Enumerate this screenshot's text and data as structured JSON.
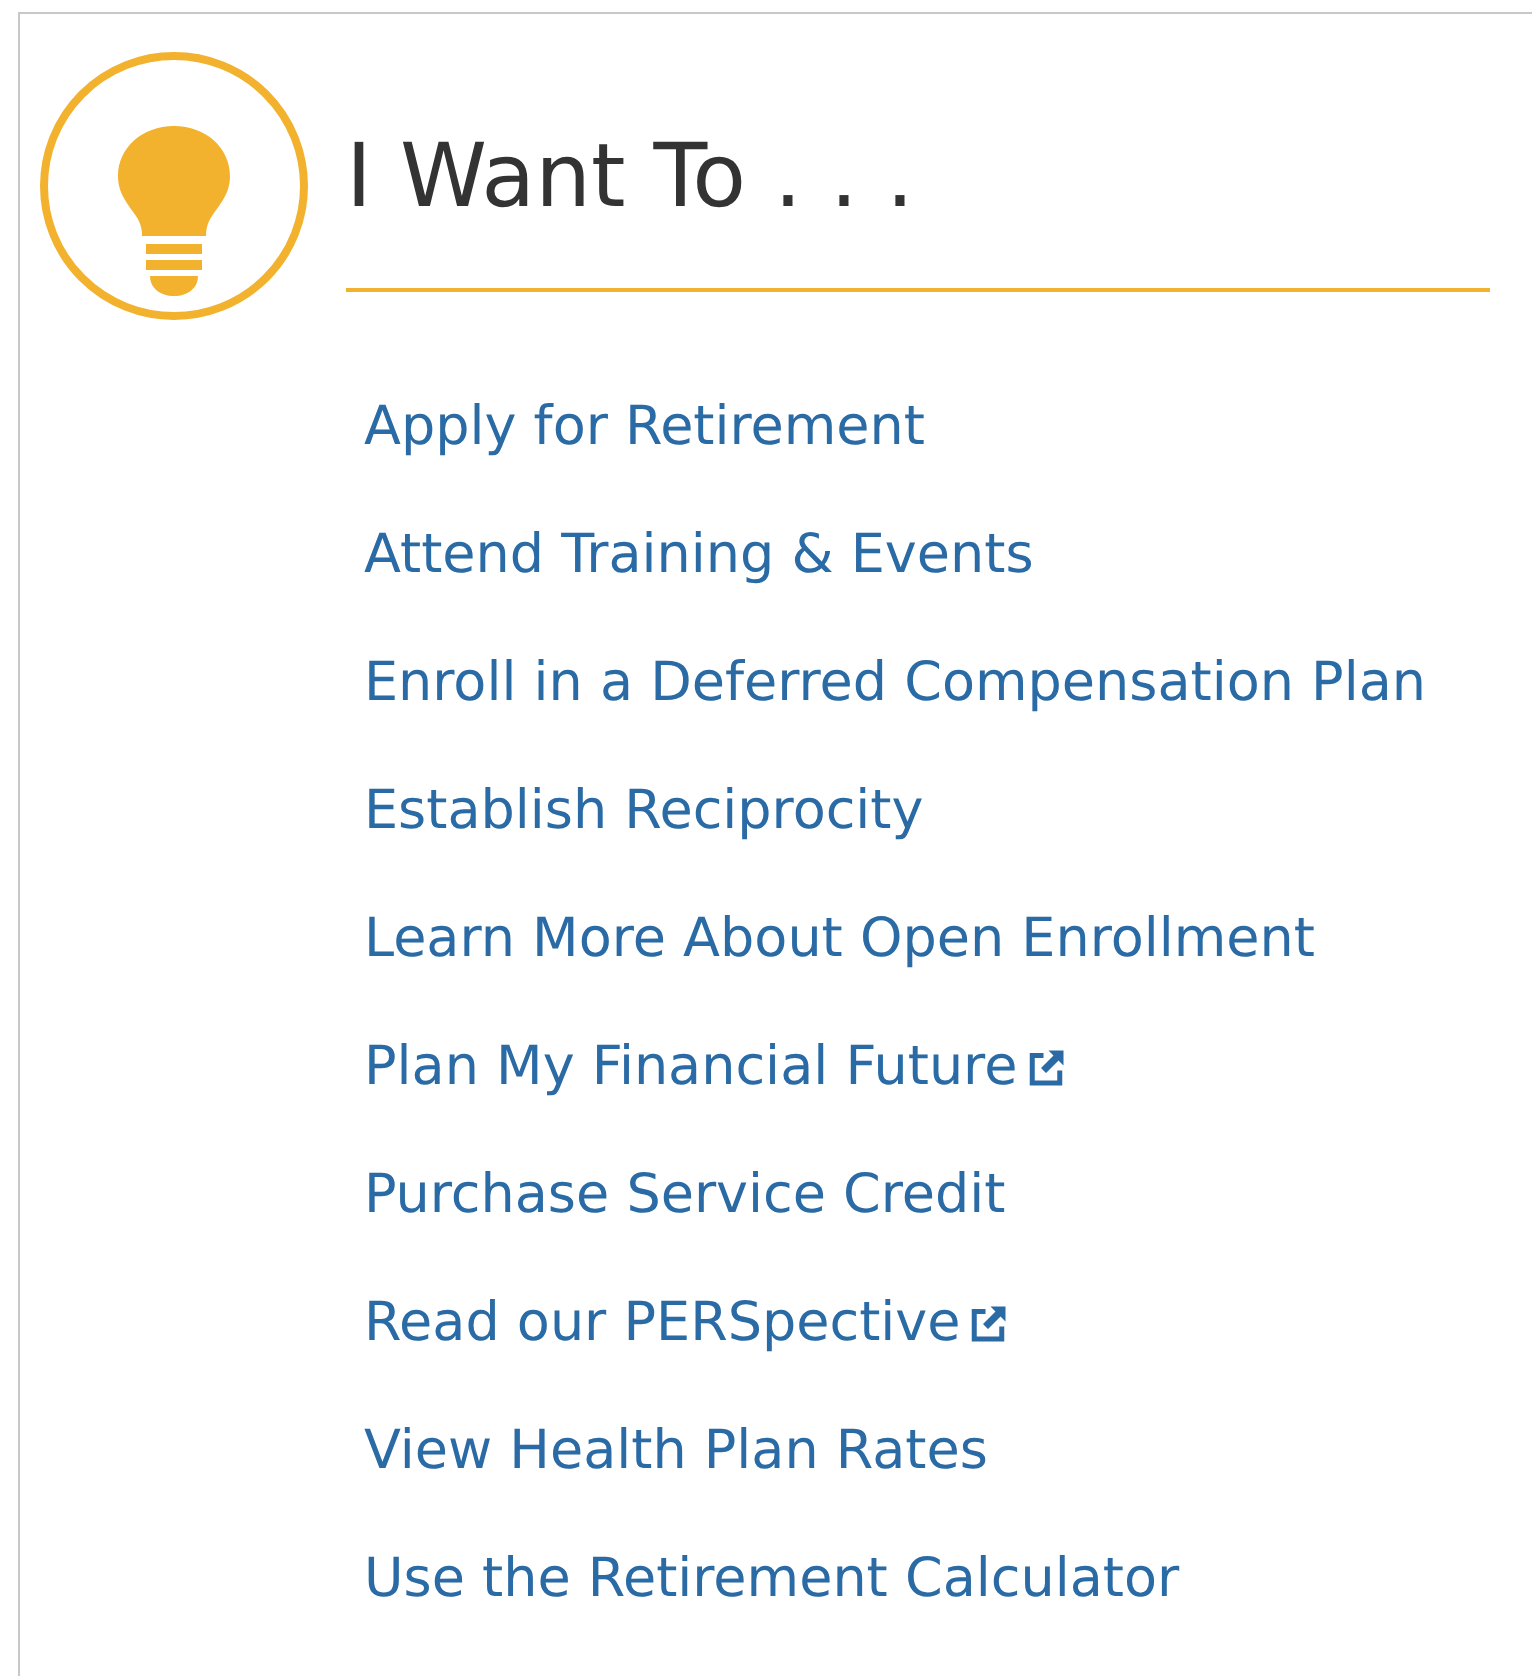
{
  "title": "I Want To . . .",
  "links": [
    {
      "label": "Apply for Retirement",
      "external": false
    },
    {
      "label": "Attend Training & Events",
      "external": false
    },
    {
      "label": "Enroll in a Deferred Compensation Plan",
      "external": false
    },
    {
      "label": "Establish Reciprocity",
      "external": false
    },
    {
      "label": "Learn More About Open Enrollment",
      "external": false
    },
    {
      "label": "Plan My Financial Future",
      "external": true
    },
    {
      "label": "Purchase Service Credit",
      "external": false
    },
    {
      "label": "Read our PERSpective",
      "external": true
    },
    {
      "label": "View Health Plan Rates",
      "external": false
    },
    {
      "label": "Use the Retirement Calculator",
      "external": false
    }
  ]
}
